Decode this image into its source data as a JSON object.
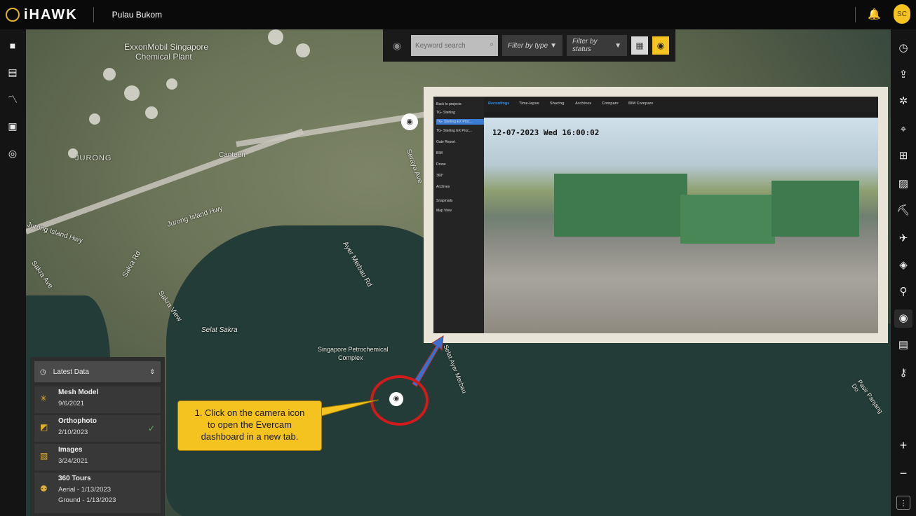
{
  "app": {
    "name": "iHAWK",
    "project": "Pulau Bukom",
    "user_initials": "SC"
  },
  "toolbar": {
    "search_placeholder": "Keyword search",
    "filter_type": "Filter by type",
    "filter_status": "Filter by status"
  },
  "map_labels": {
    "exxon": "ExxonMobil Singapore\nChemical Plant",
    "exxon_line1": "ExxonMobil Singapore",
    "exxon_line2": "Chemical Plant",
    "jurong": "JURONG",
    "canteen": "Canteen",
    "jurong_island_hwy1": "Jurong Island Hwy",
    "jurong_island_hwy2": "Jurong Island Hwy",
    "seraya": "Seraya Ave",
    "ayer_merbau": "Ayer Merbau Rd",
    "sakra_rd": "Sakra Rd",
    "sakra_ave": "Sakra Ave",
    "sakra_view": "Sakra View",
    "selat_sakra": "Selat Sakra",
    "petrochem1": "Singapore Petrochemical",
    "petrochem2": "Complex",
    "selat_ayer": "Selat Ayer Merbau",
    "pasir": "Pasir Panjang Do"
  },
  "layers": {
    "header": "Latest Data",
    "items": [
      {
        "title": "Mesh Model",
        "date": "9/6/2021",
        "icon": "mesh-icon"
      },
      {
        "title": "Orthophoto",
        "date": "2/10/2023",
        "icon": "orthophoto-icon",
        "checked": true
      },
      {
        "title": "Images",
        "date": "3/24/2021",
        "icon": "images-icon"
      },
      {
        "title": "360 Tours",
        "date": "Aerial - 1/13/2023",
        "date2": "Ground - 1/13/2023",
        "icon": "tour-icon"
      }
    ]
  },
  "callout": {
    "line1": "1. Click on the camera icon",
    "line2": "to open the Evercam",
    "line3": "dashboard in  a new tab."
  },
  "evercam": {
    "tabs": [
      "Recordings",
      "Time-lapse",
      "Sharing",
      "Archives",
      "Compare",
      "BIM Compare"
    ],
    "side": [
      "Back to projects",
      "TG- Sterling",
      "TG- Sterling EX Proc...",
      "TG- Sterling EX Proc...",
      "Gate Report",
      "BIM",
      "Drone",
      "360°",
      "Archives",
      "Snapmails",
      "Map View"
    ],
    "timestamp": "12-07-2023 Wed 16:00:02"
  },
  "colors": {
    "accent": "#f4c320",
    "callout_border": "#d11a1a",
    "arrow": "#3a6fd0"
  }
}
